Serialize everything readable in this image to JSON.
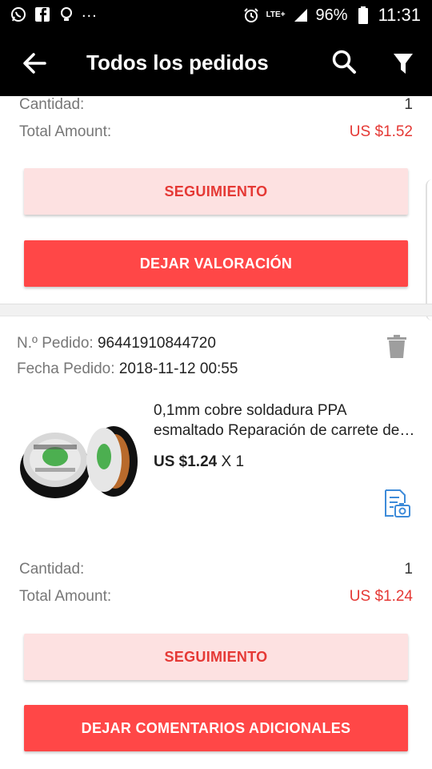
{
  "status_bar": {
    "notification_icons": [
      "whatsapp-icon",
      "facebook-icon",
      "lightbulb-icon"
    ],
    "more_indicator": "...",
    "network": "LTE+",
    "battery": "96%",
    "time": "11:31"
  },
  "app_bar": {
    "title": "Todos los pedidos",
    "back_icon": "back-arrow-icon",
    "search_icon": "search-icon",
    "filter_icon": "filter-icon"
  },
  "orders": [
    {
      "quantity_label": "Cantidad:",
      "quantity": "1",
      "total_label": "Total Amount:",
      "total": "US $1.52",
      "track_button": "SEGUIMIENTO",
      "action_button": "DEJAR VALORACIÓN"
    },
    {
      "order_no_label": "N.º Pedido:",
      "order_no": "96441910844720",
      "order_date_label": "Fecha Pedido:",
      "order_date": "2018-11-12 00:55",
      "product_title_line1": "0,1mm cobre soldadura PPA",
      "product_title_line2": "esmaltado Reparación de carrete de alambre",
      "price": "US $1.24",
      "times": "X 1",
      "quantity_label": "Cantidad:",
      "quantity": "1",
      "total_label": "Total Amount:",
      "total": "US $1.24",
      "track_button": "SEGUIMIENTO",
      "action_button": "DEJAR COMENTARIOS ADICIONALES"
    }
  ],
  "colors": {
    "accent": "#ff4747",
    "accent_light": "#fde1e1",
    "price_red": "#e53935",
    "link_blue": "#3d8bd9"
  }
}
